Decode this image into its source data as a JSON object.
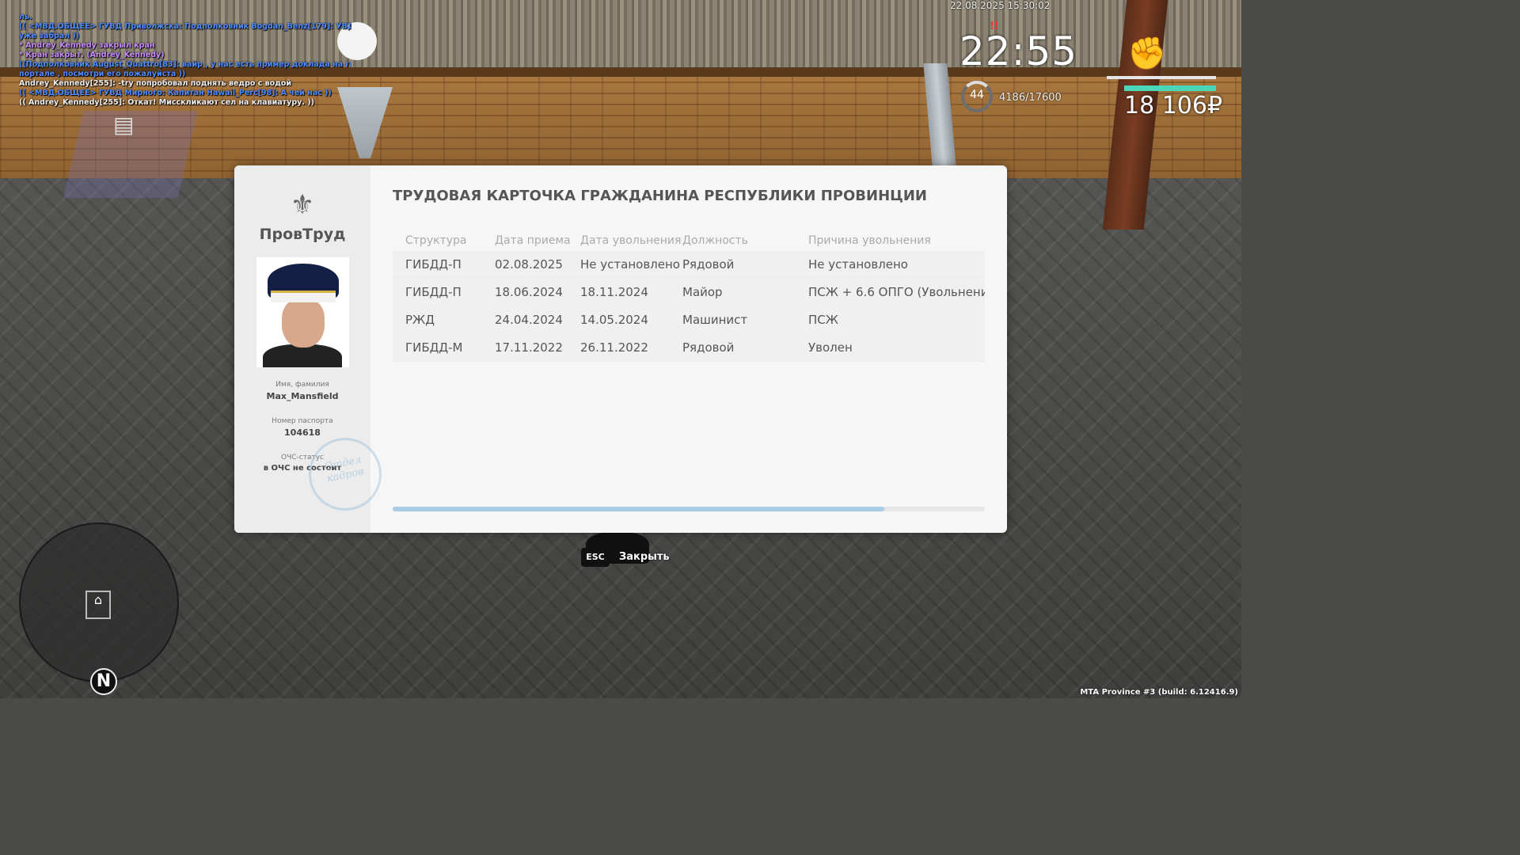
{
  "chat": [
    {
      "text": "ль.",
      "color": "blue"
    },
    {
      "text": "(( <МВД.ОБЩЕЕ> ГУВД Приволжска: Подполковник Bogdan_Benz[179]: УВД М я",
      "color": "blue"
    },
    {
      "text": "уже забрал ))",
      "color": "blue"
    },
    {
      "text": "* Andrey_Kennedy закрыл кран",
      "color": "purple"
    },
    {
      "text": "* Кран закрыт. (Andrey_Kennedy)",
      "color": "purple"
    },
    {
      "text": "((Подполковник August_Quattro[83]: вайр , у нас есть пример доклада на гос",
      "color": "blue"
    },
    {
      "text": "портале , посмотри его пожалуйста ))",
      "color": "blue"
    },
    {
      "text": "Andrey_Kennedy[255]: -try попробовал поднять ведро с водой",
      "color": "white"
    },
    {
      "text": "(( <МВД.ОБЩЕЕ> ГУВД Мирного: Капитан Hawaii_Perc[98]: А чей нас ))",
      "color": "blue"
    },
    {
      "text": "(( Andrey_Kennedy[255]: Откат! Мисскликают сел на клавиатуру. ))",
      "color": "white"
    }
  ],
  "hud": {
    "datetime": "22.08.2025 15:30:02",
    "clock": "22:55",
    "level": "44",
    "xp": "4186/17600",
    "money": "18 106₽",
    "build": "MTA Province #3 (build: 6.12416.9)",
    "compass": "N",
    "health_pct": 100,
    "armor_pct": 100,
    "icons": [
      "fist-icon",
      "house-icon",
      "document-icon"
    ]
  },
  "card": {
    "brand": "ПровТруд",
    "title": "ТРУДОВАЯ КАРТОЧКА ГРАЖДАНИНА РЕСПУБЛИКИ ПРОВИНЦИИ",
    "name_label": "Имя, фамилия",
    "name": "Max_Mansfield",
    "passport_label": "Номер паспорта",
    "passport": "104618",
    "ochs_label": "ОЧС-статус",
    "ochs": "в ОЧС не состоит",
    "stamp": "Отдел кадров",
    "columns": [
      "Структура",
      "Дата приема",
      "Дата увольнения",
      "Должность",
      "Причина увольнения"
    ],
    "rows": [
      [
        "ГИБДД-П",
        "02.08.2025",
        "Не установлено",
        "Рядовой",
        "Не установлено"
      ],
      [
        "ГИБДД-П",
        "18.06.2024",
        "18.11.2024",
        "Майор",
        "ПСЖ + 6.6 ОПГО (Увольнени"
      ],
      [
        "РЖД",
        "24.04.2024",
        "14.05.2024",
        "Машинист",
        "ПСЖ"
      ],
      [
        "ГИБДД-М",
        "17.11.2022",
        "26.11.2022",
        "Рядовой",
        "Уволен"
      ]
    ],
    "scroll_fraction": 0.83
  },
  "close": {
    "key": "ESC",
    "label": "Закрыть"
  }
}
